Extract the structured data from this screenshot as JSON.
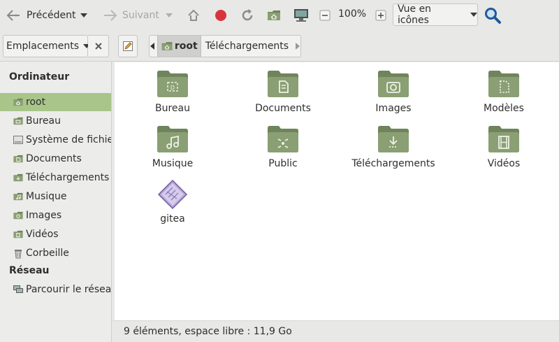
{
  "toolbar": {
    "back_label": "Précédent",
    "forward_label": "Suivant",
    "zoom": "100%",
    "view_mode": "Vue en icônes"
  },
  "locationbar": {
    "places_label": "Emplacements",
    "crumbs": [
      {
        "label": "root",
        "icon": "home-folder-icon"
      },
      {
        "label": "Téléchargements"
      }
    ]
  },
  "sidebar": {
    "computer_heading": "Ordinateur",
    "network_heading": "Réseau",
    "items": [
      {
        "label": "root",
        "icon": "home-folder-icon"
      },
      {
        "label": "Bureau",
        "icon": "desktop-folder-icon"
      },
      {
        "label": "Système de fichiers",
        "icon": "filesystem-icon"
      },
      {
        "label": "Documents",
        "icon": "documents-folder-icon"
      },
      {
        "label": "Téléchargements",
        "icon": "downloads-folder-icon"
      },
      {
        "label": "Musique",
        "icon": "music-folder-icon"
      },
      {
        "label": "Images",
        "icon": "pictures-folder-icon"
      },
      {
        "label": "Vidéos",
        "icon": "videos-folder-icon"
      },
      {
        "label": "Corbeille",
        "icon": "trash-icon"
      }
    ],
    "network_items": [
      {
        "label": "Parcourir le réseau",
        "icon": "network-icon"
      }
    ]
  },
  "files": [
    {
      "name": "Bureau",
      "icon": "desktop-folder-icon"
    },
    {
      "name": "Documents",
      "icon": "documents-folder-icon"
    },
    {
      "name": "Images",
      "icon": "pictures-folder-icon"
    },
    {
      "name": "Modèles",
      "icon": "templates-folder-icon"
    },
    {
      "name": "Musique",
      "icon": "music-folder-icon"
    },
    {
      "name": "Public",
      "icon": "public-folder-icon"
    },
    {
      "name": "Téléchargements",
      "icon": "downloads-folder-icon"
    },
    {
      "name": "Vidéos",
      "icon": "videos-folder-icon"
    },
    {
      "name": "gitea",
      "icon": "binary-file-icon"
    }
  ],
  "status": "9 éléments, espace libre : 11,9 Go",
  "colors": {
    "folder": "#8a9f73",
    "folder_tab": "#6f845b",
    "selection": "#a9c58a",
    "stop": "#d9343c",
    "search": "#1f5a9a"
  }
}
